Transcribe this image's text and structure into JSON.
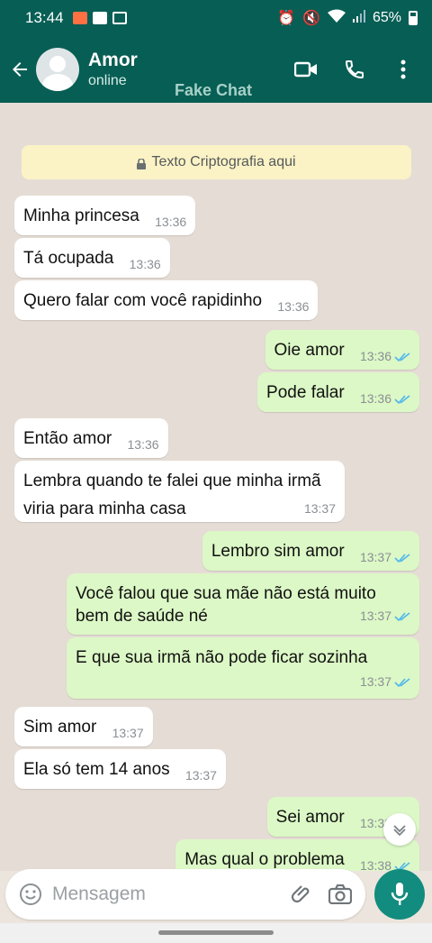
{
  "statusbar": {
    "time": "13:44",
    "battery": "65%"
  },
  "header": {
    "name": "Amor",
    "status": "online",
    "watermark": "Fake Chat"
  },
  "notice": {
    "text": "Texto Criptografia aqui"
  },
  "messages": [
    {
      "dir": "in",
      "text": "Minha princesa",
      "time": "13:36"
    },
    {
      "dir": "in",
      "text": "Tá ocupada",
      "time": "13:36"
    },
    {
      "dir": "in",
      "text": "Quero falar com você rapidinho",
      "time": "13:36"
    },
    {
      "dir": "out",
      "text": "Oie amor",
      "time": "13:36"
    },
    {
      "dir": "out",
      "text": "Pode falar",
      "time": "13:36"
    },
    {
      "dir": "in",
      "text": "Então amor",
      "time": "13:36"
    },
    {
      "dir": "in",
      "text": "Lembra quando te falei que minha irmã viria para minha casa",
      "line1": "Lembra quando te falei que minha irmã",
      "line2": "viria para minha casa",
      "time": "13:37"
    },
    {
      "dir": "out",
      "text": "Lembro sim amor",
      "time": "13:37"
    },
    {
      "dir": "out",
      "text": "Você falou que sua mãe não está muito bem de saúde né",
      "line1": "Você falou que sua mãe não está muito",
      "line2": "bem de saúde né",
      "time": "13:37"
    },
    {
      "dir": "out",
      "text": "E que sua irmã não pode ficar sozinha",
      "time": "13:37"
    },
    {
      "dir": "in",
      "text": "Sim amor",
      "time": "13:37"
    },
    {
      "dir": "in",
      "text": "Ela só tem 14 anos",
      "time": "13:37"
    },
    {
      "dir": "out",
      "text": "Sei amor",
      "time": "13:38"
    },
    {
      "dir": "out",
      "text": "Mas qual o problema",
      "time": "13:38"
    }
  ],
  "input": {
    "placeholder": "Mensagem"
  },
  "colors": {
    "header": "#075e54",
    "outgoing": "#dcf8c6",
    "incoming": "#ffffff",
    "read_ticks": "#4fb6ec",
    "mic": "#128c7e"
  }
}
